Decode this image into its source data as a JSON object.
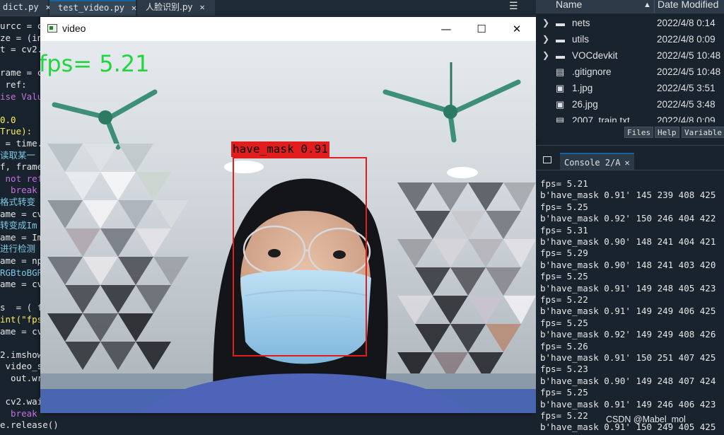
{
  "editor": {
    "tabs": [
      {
        "label": "dict.py",
        "active": false
      },
      {
        "label": "test_video.py",
        "active": true
      },
      {
        "label": "人脸识别.py",
        "active": false
      }
    ],
    "code_lines": [
      {
        "text": "urcc = c",
        "color": "#e6e6e6"
      },
      {
        "text": "ze = (in",
        "color": "#e6e6e6"
      },
      {
        "text": "t = cv2.",
        "color": "#e6e6e6"
      },
      {
        "text": "",
        "color": "#e6e6e6"
      },
      {
        "text": "rame = c",
        "color": "#e6e6e6"
      },
      {
        "text": " ref:",
        "color": "#e6e6e6"
      },
      {
        "text": "ise Valu",
        "color": "#c670e0"
      },
      {
        "text": "",
        "color": "#e6e6e6"
      },
      {
        "text": "0.0",
        "color": "#faed5c"
      },
      {
        "text": "True):",
        "color": "#faed5c"
      },
      {
        "text": " = time.",
        "color": "#e6e6e6"
      },
      {
        "text": "读取某一",
        "color": "#7ec8e3"
      },
      {
        "text": "f, frame",
        "color": "#e6e6e6"
      },
      {
        "text": " not ref",
        "color": "#c670e0"
      },
      {
        "text": "  break",
        "color": "#c670e0"
      },
      {
        "text": "格式转变",
        "color": "#7ec8e3"
      },
      {
        "text": "ame = cv",
        "color": "#e6e6e6"
      },
      {
        "text": "转变成Im",
        "color": "#7ec8e3"
      },
      {
        "text": "ame = Im",
        "color": "#e6e6e6"
      },
      {
        "text": "进行检测",
        "color": "#7ec8e3"
      },
      {
        "text": "ame = np",
        "color": "#e6e6e6"
      },
      {
        "text": "RGBtoBGR",
        "color": "#7ec8e3"
      },
      {
        "text": "ame = cv",
        "color": "#e6e6e6"
      },
      {
        "text": "",
        "color": "#e6e6e6"
      },
      {
        "text": "s  = ( f",
        "color": "#e6e6e6"
      },
      {
        "text": "int(\"fps",
        "color": "#faed5c"
      },
      {
        "text": "ame = cv",
        "color": "#e6e6e6"
      },
      {
        "text": "",
        "color": "#e6e6e6"
      },
      {
        "text": "2.imshow",
        "color": "#e6e6e6"
      },
      {
        "text": " video_s",
        "color": "#e6e6e6"
      },
      {
        "text": "  out.wr",
        "color": "#e6e6e6"
      },
      {
        "text": "",
        "color": "#e6e6e6"
      },
      {
        "text": " cv2.wai",
        "color": "#e6e6e6"
      },
      {
        "text": "  break",
        "color": "#c670e0"
      },
      {
        "text": "e.release()",
        "color": "#e6e6e6"
      }
    ]
  },
  "video_window": {
    "title": "video",
    "minimize": "—",
    "maximize": "☐",
    "close": "✕",
    "fps_overlay": "fps= 5.21",
    "detection": {
      "label": "have_mask 0.91",
      "color": "#e11d1d"
    }
  },
  "explorer": {
    "col_name": "Name",
    "col_date": "Date Modified",
    "sort_arrow": "▲",
    "rows": [
      {
        "type": "folder",
        "expandable": true,
        "name": "nets",
        "date": "2022/4/8 0:14"
      },
      {
        "type": "folder",
        "expandable": true,
        "name": "utils",
        "date": "2022/4/8 0:09"
      },
      {
        "type": "folder",
        "expandable": true,
        "name": "VOCdevkit",
        "date": "2022/4/5 10:48"
      },
      {
        "type": "file",
        "expandable": false,
        "name": ".gitignore",
        "date": "2022/4/5 10:48"
      },
      {
        "type": "image",
        "expandable": false,
        "name": "1.jpg",
        "date": "2022/4/5 3:51"
      },
      {
        "type": "image",
        "expandable": false,
        "name": "26.jpg",
        "date": "2022/4/5 3:48"
      },
      {
        "type": "file",
        "expandable": false,
        "name": "2007_train.txt",
        "date": "2022/4/8 0:09"
      }
    ],
    "panel_tabs": [
      "Files",
      "Help",
      "Variable"
    ]
  },
  "console": {
    "tab_label": "Console 2/A",
    "close": "✕",
    "lines": [
      "fps= 5.21",
      "b'have_mask 0.91' 145 239 408 425",
      "fps= 5.25",
      "b'have_mask 0.92' 150 246 404 422",
      "fps= 5.31",
      "b'have_mask 0.90' 148 241 404 421",
      "fps= 5.29",
      "b'have_mask 0.90' 148 241 403 420",
      "fps= 5.25",
      "b'have_mask 0.91' 149 248 405 423",
      "fps= 5.22",
      "b'have_mask 0.91' 149 249 406 425",
      "fps= 5.25",
      "b'have_mask 0.92' 149 249 408 426",
      "fps= 5.26",
      "b'have_mask 0.91' 150 251 407 425",
      "fps= 5.23",
      "b'have_mask 0.90' 149 248 407 424",
      "fps= 5.25",
      "b'have_mask 0.91' 149 246 406 423",
      "fps= 5.22",
      "b'have_mask 0.91' 150 249 405 425"
    ],
    "watermark": "CSDN @Mabel_mol"
  }
}
